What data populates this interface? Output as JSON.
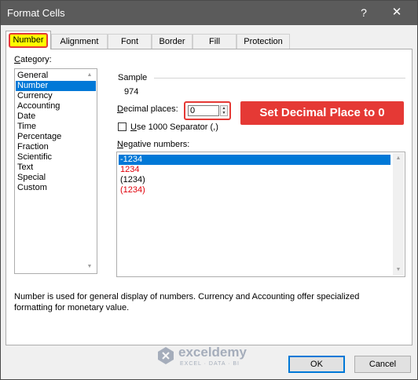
{
  "window": {
    "title": "Format Cells",
    "help_label": "?",
    "close_label": "✕"
  },
  "tabs": [
    {
      "label": "Number"
    },
    {
      "label": "Alignment"
    },
    {
      "label": "Font"
    },
    {
      "label": "Border"
    },
    {
      "label": "Fill"
    },
    {
      "label": "Protection"
    }
  ],
  "category": {
    "label_underlined": "C",
    "label_rest": "ategory:",
    "items": [
      "General",
      "Number",
      "Currency",
      "Accounting",
      "Date",
      "Time",
      "Percentage",
      "Fraction",
      "Scientific",
      "Text",
      "Special",
      "Custom"
    ],
    "selected": "Number"
  },
  "sample": {
    "label": "Sample",
    "value": "974"
  },
  "decimal_places": {
    "label_underlined": "D",
    "label_rest": "ecimal places:",
    "value": "0"
  },
  "annotation": {
    "text": "Set Decimal Place to 0",
    "color": "#e53935"
  },
  "separator": {
    "label_underlined": "U",
    "label_rest": "se 1000 Separator (,)",
    "checked": false
  },
  "negative_numbers": {
    "label_underlined": "N",
    "label_rest": "egative numbers:",
    "items": [
      {
        "text": "-1234",
        "red": false,
        "selected": true
      },
      {
        "text": "1234",
        "red": true,
        "selected": false
      },
      {
        "text": "(1234)",
        "red": false,
        "selected": false
      },
      {
        "text": "(1234)",
        "red": true,
        "selected": false
      }
    ]
  },
  "description": {
    "line1": "Number is used for general display of numbers.  Currency and Accounting offer specialized",
    "line2": "formatting for monetary value."
  },
  "watermark": {
    "name": "exceldemy",
    "tagline": "EXCEL · DATA · BI"
  },
  "buttons": {
    "ok": "OK",
    "cancel": "Cancel"
  },
  "colors": {
    "titlebar": "#5b5b5b",
    "selection": "#0078d7",
    "highlight": "#ffff00"
  }
}
